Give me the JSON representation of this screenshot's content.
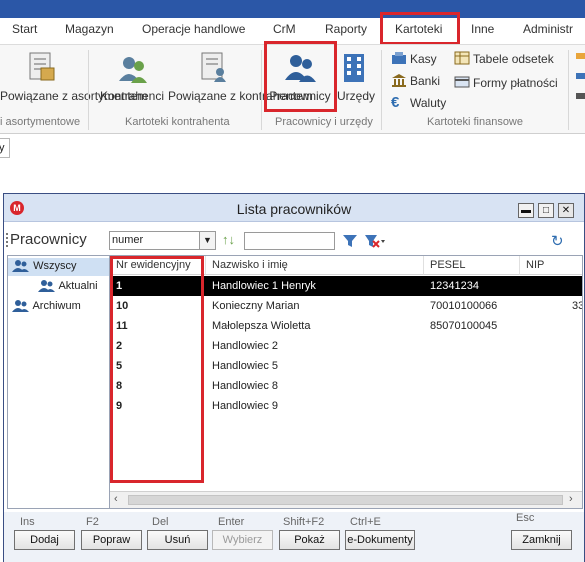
{
  "menu": {
    "items": [
      "Start",
      "Magazyn",
      "Operacje handlowe",
      "CrM",
      "Raporty",
      "Kartoteki",
      "Inne",
      "Administr"
    ],
    "active": "Kartoteki"
  },
  "ribbon": {
    "btn_powiazane_asort": "Powiązane z asortymentem",
    "btn_kontrahenci": "Kontrahenci",
    "btn_powiazane_kontr": "Powiązane z kontrahentem",
    "btn_pracownicy": "Pracownicy",
    "btn_urzedy": "Urzędy",
    "small": [
      "Kasy",
      "Banki",
      "Waluty",
      "Tabele odsetek",
      "Formy płatności"
    ],
    "groups": [
      "i asortymentowe",
      "Kartoteki kontrahenta",
      "Pracownicy i urzędy",
      "Kartoteki finansowe"
    ]
  },
  "tabstub": "y",
  "window": {
    "app_icon": "M",
    "title": "Lista pracowników",
    "controls": [
      "▬",
      "□",
      "✕"
    ]
  },
  "toolbar": {
    "title": "Pracownicy",
    "field_select": "numer",
    "search_value": ""
  },
  "tree": {
    "items": [
      "Wszyscy",
      "Aktualni",
      "Archiwum"
    ],
    "selected": "Wszyscy"
  },
  "grid": {
    "columns": [
      "Nr ewidencyjny",
      "Nazwisko i imię",
      "PESEL",
      "NIP"
    ],
    "rows": [
      {
        "nr": "1",
        "name": "Handlowiec 1 Henryk",
        "pesel": "12341234",
        "nip": "",
        "selected": true
      },
      {
        "nr": "10",
        "name": "Konieczny Marian",
        "pesel": "70010100066",
        "nip": "33",
        "selected": false
      },
      {
        "nr": "11",
        "name": "Małolepsza Wioletta",
        "pesel": "85070100045",
        "nip": "",
        "selected": false
      },
      {
        "nr": "2",
        "name": "Handlowiec 2",
        "pesel": "",
        "nip": "",
        "selected": false
      },
      {
        "nr": "5",
        "name": "Handlowiec 5",
        "pesel": "",
        "nip": "",
        "selected": false
      },
      {
        "nr": "8",
        "name": "Handlowiec 8",
        "pesel": "",
        "nip": "",
        "selected": false
      },
      {
        "nr": "9",
        "name": "Handlowiec 9",
        "pesel": "",
        "nip": "",
        "selected": false
      }
    ]
  },
  "bottom": {
    "buttons": [
      {
        "key": "Ins",
        "label": "Dodaj",
        "enabled": true
      },
      {
        "key": "F2",
        "label": "Popraw",
        "enabled": true
      },
      {
        "key": "Del",
        "label": "Usuń",
        "enabled": true
      },
      {
        "key": "Enter",
        "label": "Wybierz",
        "enabled": false
      },
      {
        "key": "Shift+F2",
        "label": "Pokaż",
        "enabled": true
      },
      {
        "key": "Ctrl+E",
        "label": "e-Dokumenty",
        "enabled": true
      },
      {
        "key": "Esc",
        "label": "Zamknij",
        "enabled": true
      }
    ]
  },
  "colors": {
    "highlight": "#d9262c",
    "topbar": "#2b57a7",
    "selected_row": "#000000"
  }
}
